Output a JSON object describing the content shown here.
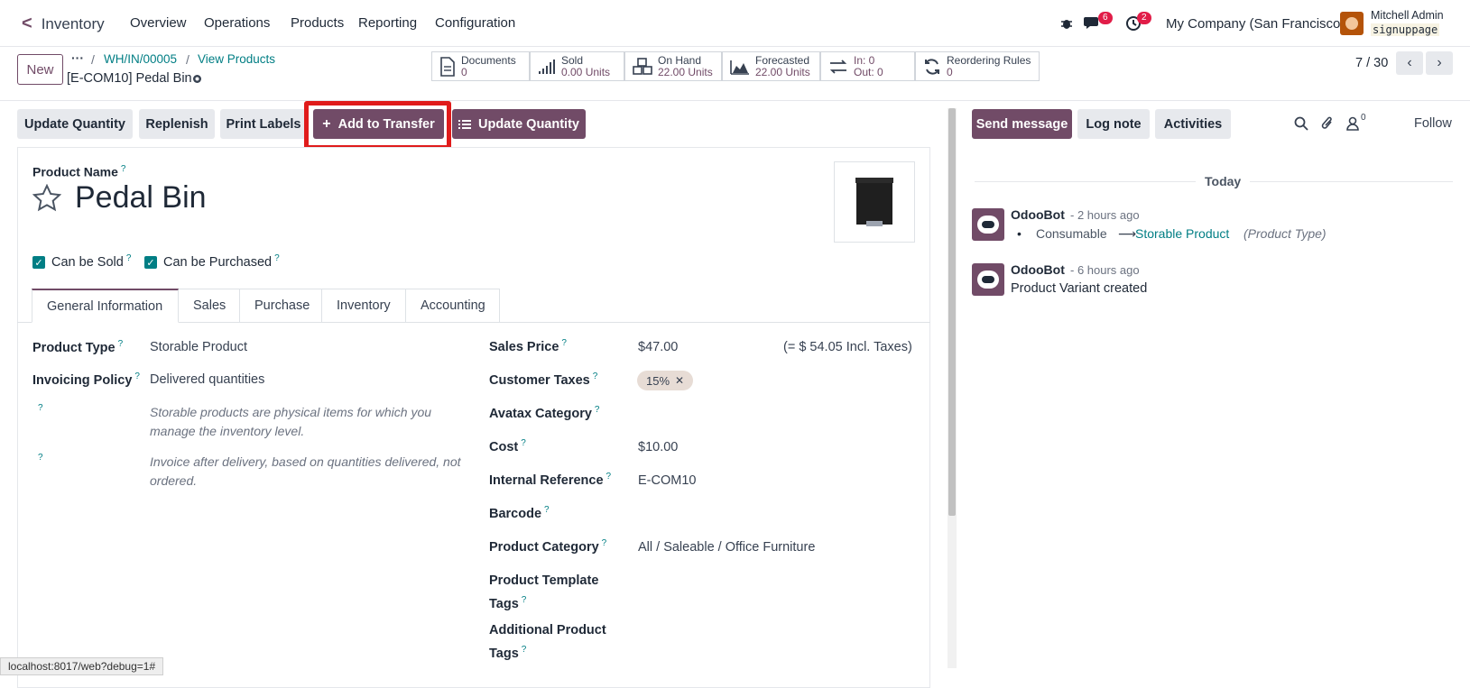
{
  "navbar": {
    "app_name": "Inventory",
    "menus": [
      "Overview",
      "Operations",
      "Products",
      "Reporting",
      "Configuration"
    ],
    "messages_count": "6",
    "activities_count": "2",
    "company": "My Company (San Francisco)",
    "user_name": "Mitchell Admin",
    "db_name": "signuppage"
  },
  "control": {
    "new_label": "New",
    "breadcrumb_dots": "···",
    "breadcrumb": [
      "WH/IN/00005",
      "View Products"
    ],
    "record_title": "[E-COM10] Pedal Bin",
    "pager": "7 / 30"
  },
  "smart_buttons": [
    {
      "title": "Documents",
      "value": "0",
      "icon": "document-icon"
    },
    {
      "title": "Sold",
      "value": "0.00 Units",
      "icon": "bar-chart-icon"
    },
    {
      "title": "On Hand",
      "value": "22.00 Units",
      "icon": "cubes-icon"
    },
    {
      "title": "Forecasted",
      "value": "22.00 Units",
      "icon": "area-chart-icon"
    },
    {
      "title": "In: 0",
      "value": "Out: 0",
      "icon": "exchange-icon"
    },
    {
      "title": "Reordering Rules",
      "value": "0",
      "icon": "refresh-icon"
    }
  ],
  "actions": {
    "update_quantity": "Update Quantity",
    "replenish": "Replenish",
    "print_labels": "Print Labels",
    "add_to_transfer": "Add to Transfer",
    "update_quantity_2": "Update Quantity"
  },
  "form": {
    "product_name_label": "Product Name",
    "product_name": "Pedal Bin",
    "can_be_sold": "Can be Sold",
    "can_be_purchased": "Can be Purchased",
    "tabs": [
      "General Information",
      "Sales",
      "Purchase",
      "Inventory",
      "Accounting"
    ],
    "left": {
      "product_type_label": "Product Type",
      "product_type": "Storable Product",
      "invoicing_policy_label": "Invoicing Policy",
      "invoicing_policy": "Delivered quantities",
      "help1": "Storable products are physical items for which you manage the inventory level.",
      "help2": "Invoice after delivery, based on quantities delivered, not ordered."
    },
    "right": {
      "sales_price_label": "Sales Price",
      "sales_price": "$47.00",
      "incl_taxes": "(= $ 54.05 Incl. Taxes)",
      "customer_taxes_label": "Customer Taxes",
      "customer_tax_tag": "15%",
      "avatax_label": "Avatax Category",
      "cost_label": "Cost",
      "cost": "$10.00",
      "internal_ref_label": "Internal Reference",
      "internal_ref": "E-COM10",
      "barcode_label": "Barcode",
      "product_category_label": "Product Category",
      "product_category": "All / Saleable / Office Furniture",
      "template_tags_label_1": "Product Template",
      "template_tags_label_2": "Tags",
      "additional_tags_label_1": "Additional Product",
      "additional_tags_label_2": "Tags"
    }
  },
  "chatter": {
    "send_message": "Send message",
    "log_note": "Log note",
    "activities": "Activities",
    "followers_count": "0",
    "follow": "Follow",
    "today": "Today",
    "messages": [
      {
        "author": "OdooBot",
        "time": "- 2 hours ago",
        "old": "Consumable",
        "arrow": "⟶",
        "new": "Storable Product",
        "field": "(Product Type)"
      },
      {
        "author": "OdooBot",
        "time": "- 6 hours ago",
        "body": "Product Variant created"
      }
    ]
  },
  "statusbar": "localhost:8017/web?debug=1#",
  "colors": {
    "primary": "#714B67",
    "link": "#017e84",
    "highlight": "#e01b1b"
  }
}
